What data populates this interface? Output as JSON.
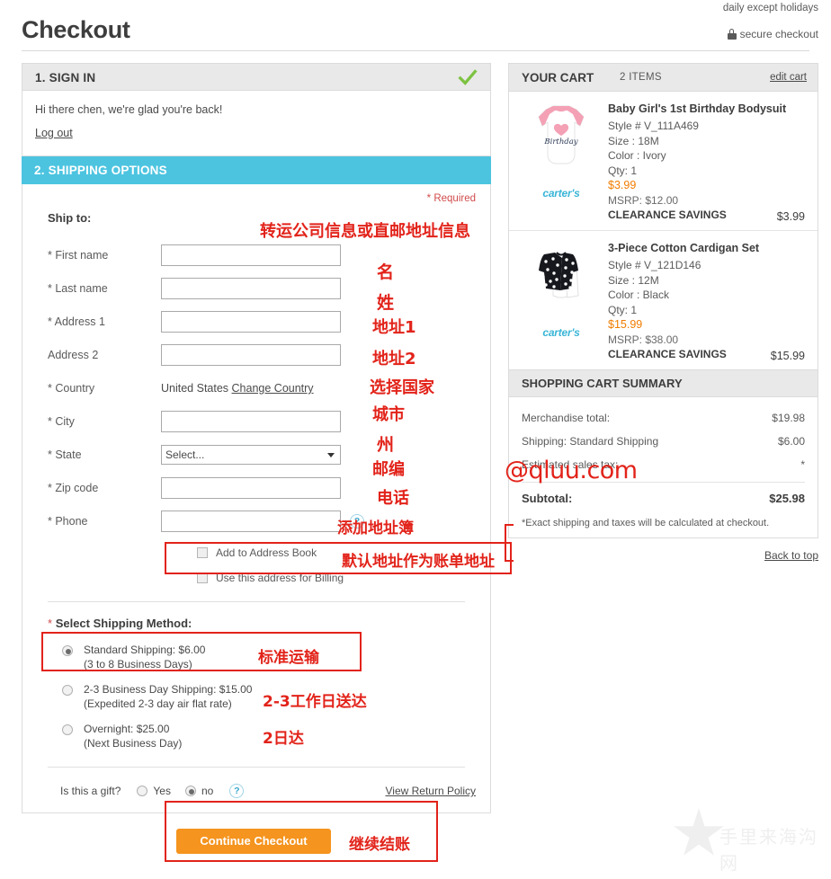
{
  "header": {
    "title": "Checkout",
    "hours_note": "daily except holidays",
    "secure_label": "secure checkout",
    "lock_icon": "lock-icon"
  },
  "signin": {
    "bar_title": "1. SIGN IN",
    "check_icon": "green-check-icon",
    "greeting": "Hi there chen, we're glad you're back!",
    "logout_label": "Log out"
  },
  "shipping": {
    "bar_title": "2. SHIPPING OPTIONS",
    "required_note": "* Required",
    "ship_to_label": "Ship to:",
    "fields": [
      {
        "label": "* First name",
        "value": "",
        "type": "text"
      },
      {
        "label": "* Last name",
        "value": "",
        "type": "text"
      },
      {
        "label": "* Address 1",
        "value": "",
        "type": "text"
      },
      {
        "label": "Address 2",
        "value": "",
        "type": "text"
      },
      {
        "label": "* Country",
        "value": "United States",
        "change_link": "Change Country",
        "type": "static"
      },
      {
        "label": "* City",
        "value": "",
        "type": "text"
      },
      {
        "label": "* State",
        "value": "Select...",
        "type": "select"
      },
      {
        "label": "* Zip code",
        "value": "",
        "type": "text"
      },
      {
        "label": "* Phone",
        "value": "",
        "type": "text",
        "help": "?"
      }
    ],
    "checkboxes": [
      {
        "label": "Add to Address Book",
        "checked": false
      },
      {
        "label": "Use this address for Billing",
        "checked": false
      }
    ],
    "method_title": "* Select Shipping Method:",
    "methods": [
      {
        "line1": "Standard Shipping: $6.00",
        "line2": "(3 to 8 Business Days)",
        "selected": true
      },
      {
        "line1": "2-3 Business Day Shipping: $15.00",
        "line2": "(Expedited 2-3 day air flat rate)",
        "selected": false
      },
      {
        "line1": "Overnight: $25.00",
        "line2": "(Next Business Day)",
        "selected": false
      }
    ],
    "gift_question": "Is this a gift?",
    "gift_yes": "Yes",
    "gift_no": "no",
    "gift_help": "?",
    "gift_selected": "no",
    "return_policy": "View Return Policy",
    "continue_label": "Continue Checkout"
  },
  "cart": {
    "title": "YOUR CART",
    "item_count": "2 ITEMS",
    "edit_label": "edit cart",
    "brand": "carter's",
    "items": [
      {
        "name": "Baby Girl's 1st Birthday Bodysuit",
        "style": "Style # V_111A469",
        "size": "Size : 18M",
        "color": "Color : Ivory",
        "qty": "Qty: 1",
        "price": "$3.99",
        "msrp": "MSRP: $12.00",
        "savings": "CLEARANCE SAVINGS",
        "line_total": "$3.99",
        "thumb": "baby-bodysuit-thumb"
      },
      {
        "name": "3-Piece Cotton Cardigan Set",
        "style": "Style # V_121D146",
        "size": "Size : 12M",
        "color": "Color : Black",
        "qty": "Qty: 1",
        "price": "$15.99",
        "msrp": "MSRP: $38.00",
        "savings": "CLEARANCE SAVINGS",
        "line_total": "$15.99",
        "thumb": "cardigan-set-thumb"
      }
    ]
  },
  "summary": {
    "title": "SHOPPING CART SUMMARY",
    "rows": [
      {
        "label": "Merchandise total:",
        "value": "$19.98"
      },
      {
        "label": "Shipping: Standard Shipping",
        "value": "$6.00"
      },
      {
        "label": "Estimated sales tax:",
        "value": "*"
      }
    ],
    "subtotal_label": "Subtotal:",
    "subtotal_value": "$25.98",
    "note": "*Exact shipping and taxes will be calculated at checkout.",
    "back_to_top": "Back to top"
  },
  "annotations": {
    "ship_to": "转运公司信息或直邮地址信息",
    "first_name": "名",
    "last_name": "姓",
    "address1": "地址1",
    "address2": "地址2",
    "country": "选择国家",
    "city": "城市",
    "state": "州",
    "zip": "邮编",
    "phone": "电话",
    "address_book": "添加地址簿",
    "billing": "默认地址作为账单地址",
    "standard": "标准运输",
    "two_three_day": "2-3工作日送达",
    "overnight": "2日达",
    "continue": "继续结账"
  },
  "watermarks": {
    "site": "@qluu.com",
    "bottom_text": "手里来海沟网",
    "star_icon": "star-icon"
  },
  "colors": {
    "accent_blue": "#4cc4e0",
    "accent_orange": "#f5941e",
    "check_green": "#7dc242",
    "annotation_red": "#e2231a",
    "price_orange": "#f07d00",
    "brand_blue": "#3ab5d6"
  }
}
